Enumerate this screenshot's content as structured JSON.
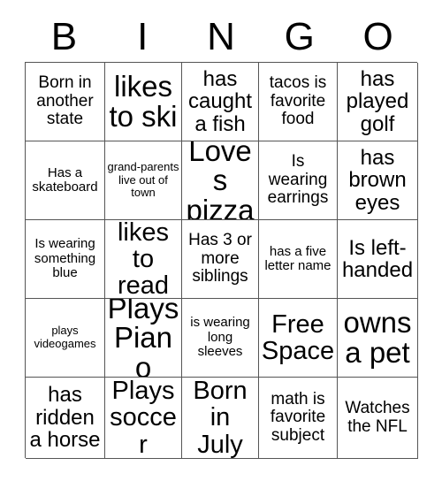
{
  "card": {
    "title": "BINGO",
    "header_letters": [
      "B",
      "I",
      "N",
      "G",
      "O"
    ],
    "grid_size": "5x5",
    "free_space_cell": "Free Space",
    "colors": {
      "background": "#ffffff",
      "text": "#000000",
      "grid_line": "#555555"
    },
    "rows": [
      {
        "cells": [
          {
            "text": "Born in another state",
            "size": "m"
          },
          {
            "text": "likes to ski",
            "size": "xxl"
          },
          {
            "text": "has caught a fish",
            "size": "l"
          },
          {
            "text": "tacos is favorite food",
            "size": "m"
          },
          {
            "text": "has played golf",
            "size": "l"
          }
        ]
      },
      {
        "cells": [
          {
            "text": "Has a skateboard",
            "size": "s"
          },
          {
            "text": "grand-parents live out of town",
            "size": "xs"
          },
          {
            "text": "Loves pizza",
            "size": "xxl"
          },
          {
            "text": "Is wearing earrings",
            "size": "m"
          },
          {
            "text": "has brown eyes",
            "size": "l"
          }
        ]
      },
      {
        "cells": [
          {
            "text": "Is wearing something blue",
            "size": "s"
          },
          {
            "text": "likes to read",
            "size": "xl"
          },
          {
            "text": "Has 3 or more siblings",
            "size": "m"
          },
          {
            "text": "has a five letter name",
            "size": "s"
          },
          {
            "text": "Is left-handed",
            "size": "l"
          }
        ]
      },
      {
        "cells": [
          {
            "text": "plays videogames",
            "size": "xs"
          },
          {
            "text": "Plays Piano",
            "size": "xxl"
          },
          {
            "text": "is wearing long sleeves",
            "size": "s"
          },
          {
            "text": "Free Space",
            "size": "xl"
          },
          {
            "text": "owns a pet",
            "size": "xxl"
          }
        ]
      },
      {
        "cells": [
          {
            "text": "has ridden a horse",
            "size": "l"
          },
          {
            "text": "Plays soccer",
            "size": "xl"
          },
          {
            "text": "Born in July",
            "size": "xl"
          },
          {
            "text": "math is favorite subject",
            "size": "m"
          },
          {
            "text": "Watches the NFL",
            "size": "m"
          }
        ]
      }
    ]
  }
}
